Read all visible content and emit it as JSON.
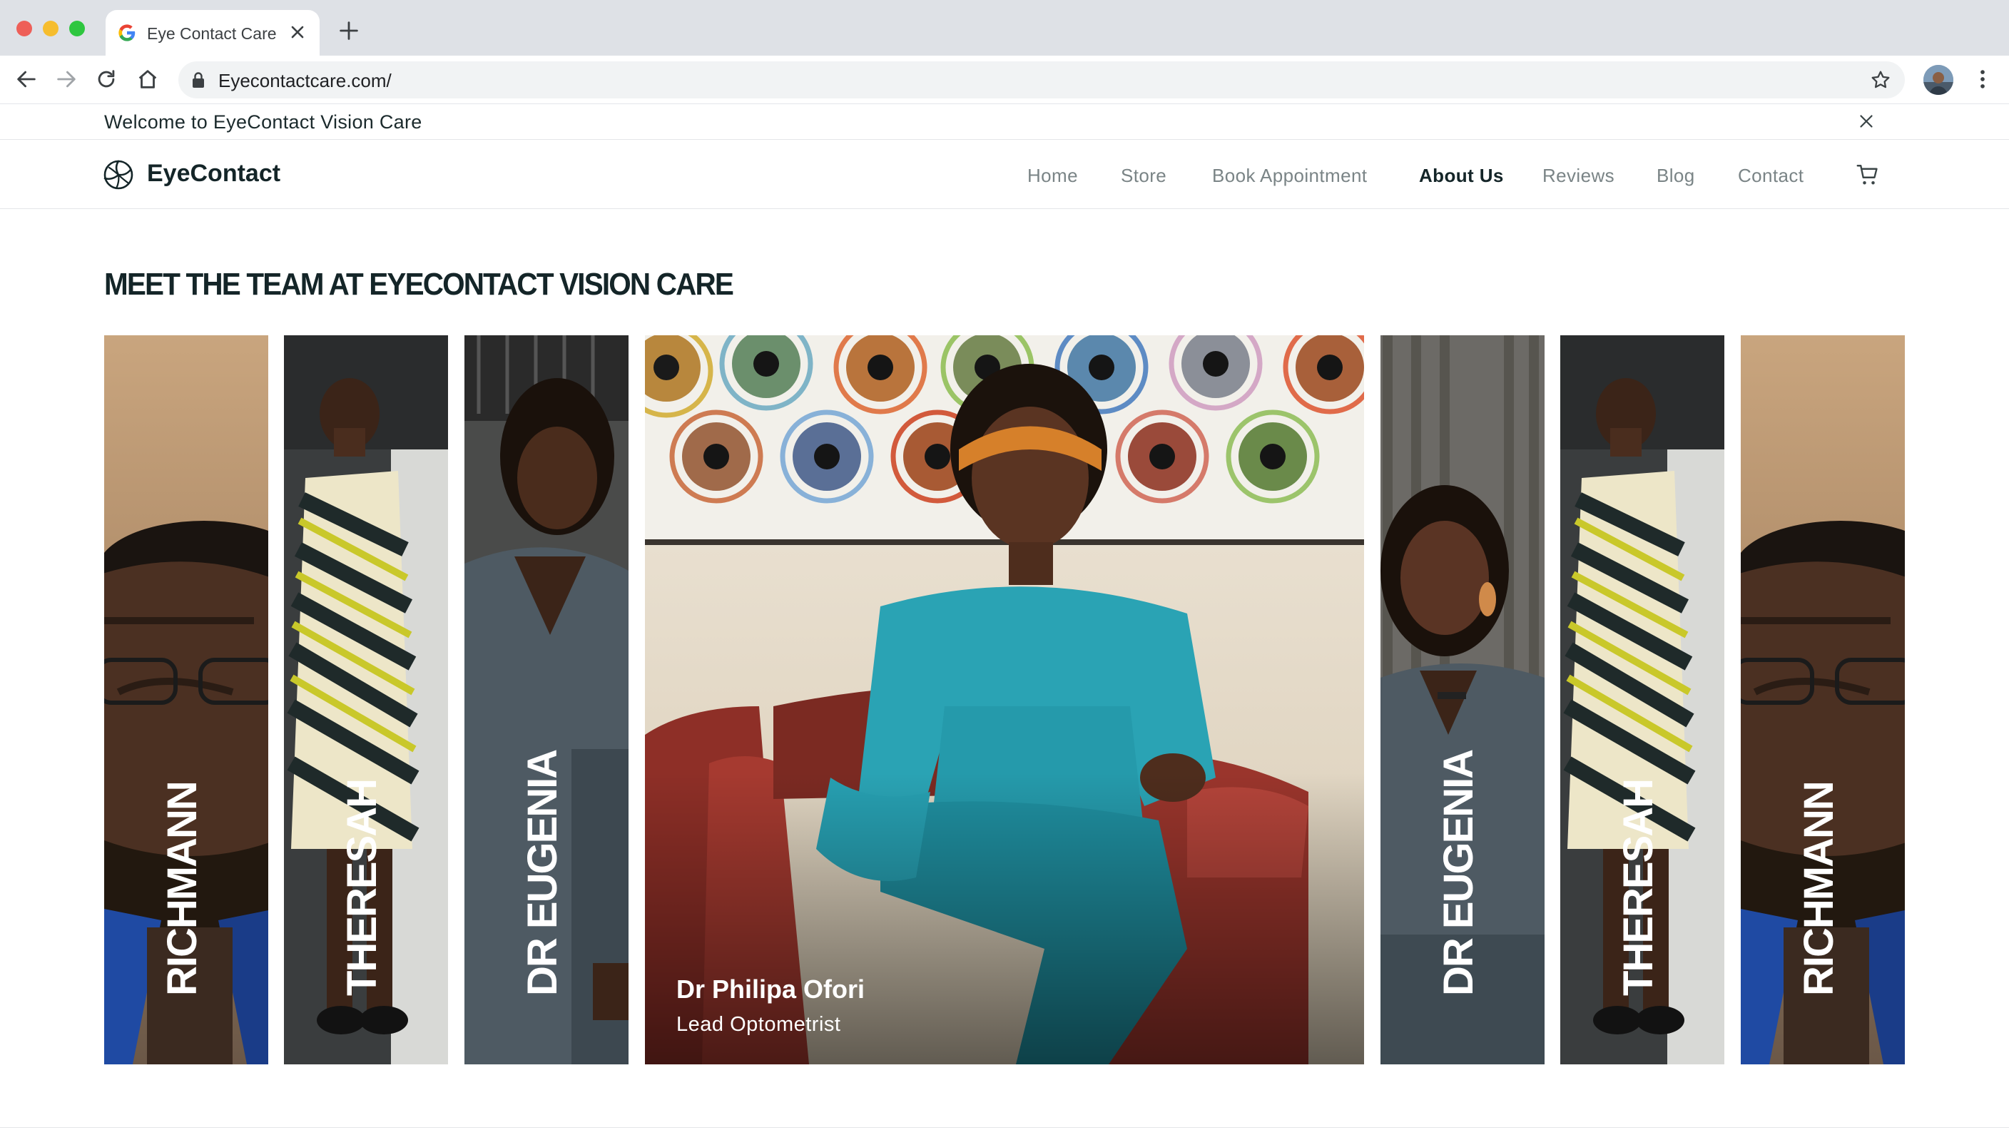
{
  "browser": {
    "tab_title": "Eye Contact Care",
    "url": "Eyecontactcare.com/"
  },
  "announcement": {
    "text": "Welcome to EyeContact Vision Care"
  },
  "header": {
    "logo_text": "EyeContact",
    "nav": [
      {
        "label": "Home",
        "active": false
      },
      {
        "label": "Store",
        "active": false
      },
      {
        "label": "Book Appointment",
        "active": false
      },
      {
        "label": "About Us",
        "active": true
      },
      {
        "label": "Reviews",
        "active": false
      },
      {
        "label": "Blog",
        "active": false
      },
      {
        "label": "Contact",
        "active": false
      }
    ]
  },
  "team": {
    "heading": "MEET THE TEAM AT EYECONTACT VISION CARE",
    "strips": [
      {
        "name": "RICHMANN"
      },
      {
        "name": "THERESAH"
      },
      {
        "name": "DR EUGENIA"
      },
      {
        "name": "DR EUGENIA"
      },
      {
        "name": "THERESAH"
      },
      {
        "name": "RICHMANN"
      }
    ],
    "featured": {
      "name": "Dr Philipa Ofori",
      "role": "Lead Optometrist"
    }
  },
  "colors": {
    "brand_dark": "#142528",
    "nav_inactive": "#7a8486",
    "chrome_bg": "#dee1e6"
  },
  "icons": [
    "google-favicon-icon",
    "close-icon",
    "plus-icon",
    "back-arrow-icon",
    "forward-arrow-icon",
    "reload-icon",
    "home-icon",
    "lock-icon",
    "star-icon",
    "kebab-menu-icon",
    "cart-icon"
  ]
}
